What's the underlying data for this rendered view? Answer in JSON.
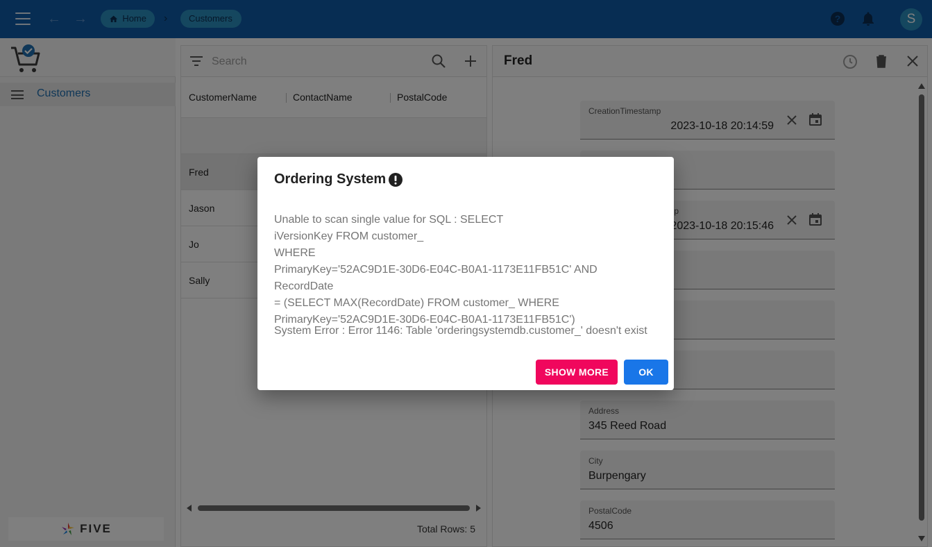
{
  "header": {
    "breadcrumbs": [
      {
        "label": "Home"
      },
      {
        "label": "Customers"
      }
    ],
    "avatar_initial": "S",
    "colors": {
      "appbar": "#0f5aa6",
      "crumb": "#2a8fbe"
    }
  },
  "sidebar": {
    "items": [
      {
        "label": "Customers"
      }
    ],
    "footer_logo_text": "FIVE"
  },
  "list": {
    "search_placeholder": "Search",
    "columns": [
      "CustomerName",
      "ContactName",
      "PostalCode"
    ],
    "rows": [
      {
        "name": "Fred"
      },
      {
        "name": "Jason"
      },
      {
        "name": "Jo"
      },
      {
        "name": "Sally"
      }
    ],
    "total_rows": "Total Rows: 5"
  },
  "form": {
    "title": "Fred",
    "fields": [
      {
        "label": "CreationTimestamp",
        "value": "2023-10-18 20:14:59"
      },
      {
        "label": "",
        "value": ""
      },
      {
        "label": "p",
        "value": "2023-10-18 20:15:46"
      },
      {
        "label": "",
        "value": ""
      },
      {
        "label": "",
        "value": ""
      },
      {
        "label": "",
        "value": ""
      },
      {
        "label": "Address",
        "value": "345 Reed Road"
      },
      {
        "label": "City",
        "value": "Burpengary"
      },
      {
        "label": "PostalCode",
        "value": "4506"
      }
    ]
  },
  "dialog": {
    "title": "Ordering System",
    "message": "Unable to scan single value for SQL : SELECT\niVersionKey FROM customer_\nWHERE\nPrimaryKey='52AC9D1E-30D6-E04C-B0A1-1173E11FB51C' AND RecordDate\n= (SELECT MAX(RecordDate) FROM customer_ WHERE\nPrimaryKey='52AC9D1E-30D6-E04C-B0A1-1173E11FB51C')",
    "system_error": "System Error : Error 1146: Table 'orderingsystemdb.customer_' doesn't exist",
    "show_more_label": "SHOW MORE",
    "ok_label": "OK",
    "colors": {
      "show_more": "#f0075d",
      "ok": "#1976e8"
    }
  }
}
